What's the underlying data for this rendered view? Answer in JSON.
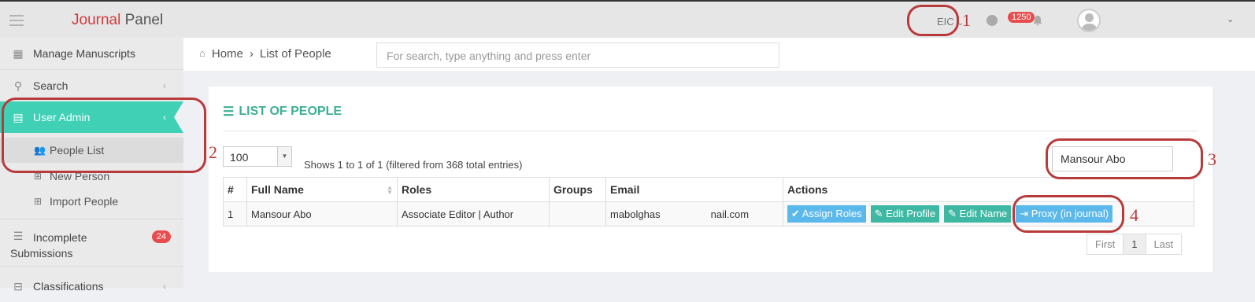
{
  "header": {
    "brand_first": "Journal",
    "brand_second": " Panel",
    "role": "EIC",
    "notifications_count": "1250"
  },
  "sidebar": {
    "items": [
      {
        "label": "Manage Manuscripts",
        "icon": "dashboard-icon"
      },
      {
        "label": "Search",
        "icon": "search-icon"
      },
      {
        "label": "User Admin",
        "icon": "book-icon"
      },
      {
        "label": "People List",
        "icon": "users-icon"
      },
      {
        "label": "New Person",
        "icon": "plus-square-icon"
      },
      {
        "label": "Import People",
        "icon": "plus-square-icon"
      },
      {
        "label": "Incomplete Submissions",
        "icon": "list-icon",
        "badge": "24"
      },
      {
        "label": "Classifications",
        "icon": "tag-icon"
      }
    ]
  },
  "breadcrumb": {
    "home": "Home",
    "current": "List of People"
  },
  "search": {
    "placeholder": "For search, type anything and press enter"
  },
  "panel": {
    "title": "LIST OF PEOPLE",
    "page_size": "100",
    "info": "Shows 1 to 1 of 1 (filtered from 368 total entries)",
    "filter_value": "Mansour Abo"
  },
  "table": {
    "headers": [
      "#",
      "Full Name",
      "Roles",
      "Groups",
      "Email",
      "Actions"
    ],
    "rows": [
      {
        "num": "1",
        "name": "Mansour Abo",
        "roles": "Associate Editor | Author",
        "groups": "",
        "email_start": "mabolghas",
        "email_end": "nail.com",
        "actions": [
          "Assign Roles",
          "Edit Profile",
          "Edit Name",
          "Proxy (in journal)"
        ]
      }
    ]
  },
  "pagination": {
    "first": "First",
    "page": "1",
    "last": "Last"
  },
  "annotations": [
    "1",
    "2",
    "3",
    "4"
  ],
  "colors": {
    "accent": "#3fd0b5",
    "title": "#3daf94",
    "annotation": "#b83b3b",
    "badge": "#e84c4c"
  }
}
